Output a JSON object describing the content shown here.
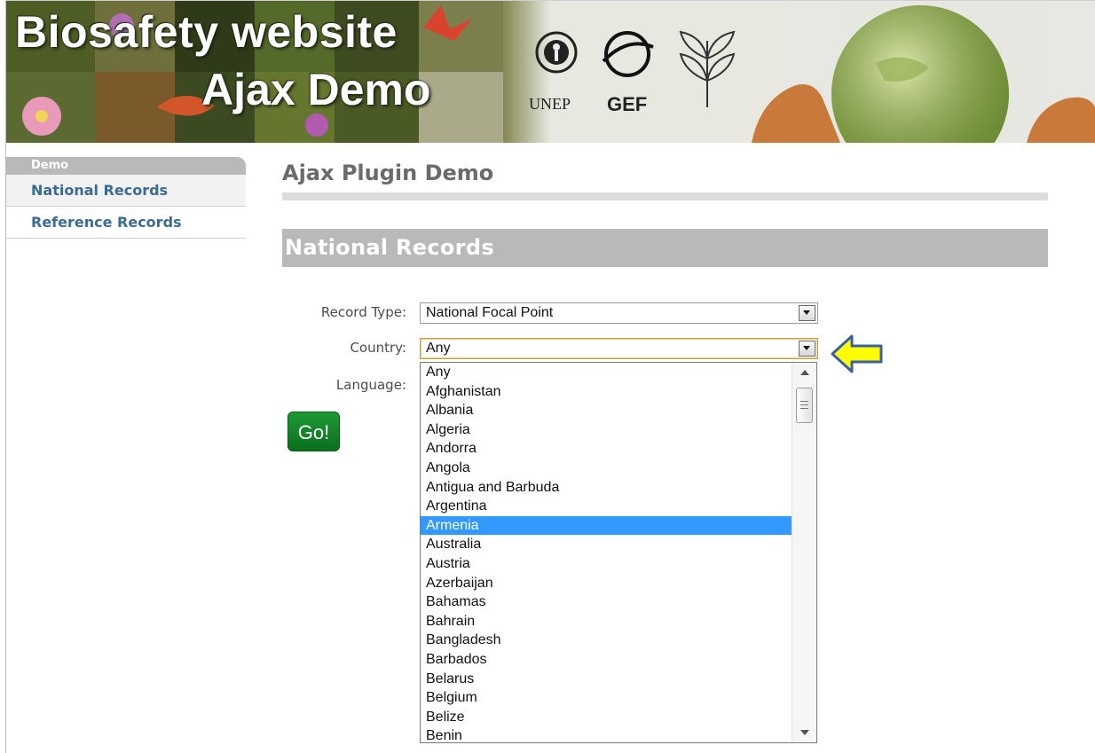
{
  "banner": {
    "title": "Biosafety website",
    "subtitle": "Ajax Demo",
    "logo_unep": "UNEP",
    "logo_gef": "GEF"
  },
  "sidebar": {
    "heading": "Demo",
    "items": [
      {
        "label": "National Records"
      },
      {
        "label": "Reference Records"
      }
    ]
  },
  "main": {
    "page_title": "Ajax Plugin Demo",
    "section_title": "National Records",
    "form": {
      "record_type_label": "Record Type:",
      "record_type_value": "National Focal Point",
      "country_label": "Country:",
      "country_value": "Any",
      "language_label": "Language:",
      "go_label": "Go!"
    }
  },
  "country_dropdown": {
    "options": [
      "Any",
      "Afghanistan",
      "Albania",
      "Algeria",
      "Andorra",
      "Angola",
      "Antigua and Barbuda",
      "Argentina",
      "Armenia",
      "Australia",
      "Austria",
      "Azerbaijan",
      "Bahamas",
      "Bahrain",
      "Bangladesh",
      "Barbados",
      "Belarus",
      "Belgium",
      "Belize",
      "Benin"
    ],
    "highlighted": "Armenia"
  },
  "colors": {
    "link": "#3a6b93",
    "section_bar": "#b9b9b9",
    "highlight": "#3399ff",
    "go_button": "#0b6e1d",
    "callout_arrow": "#ffff00"
  }
}
